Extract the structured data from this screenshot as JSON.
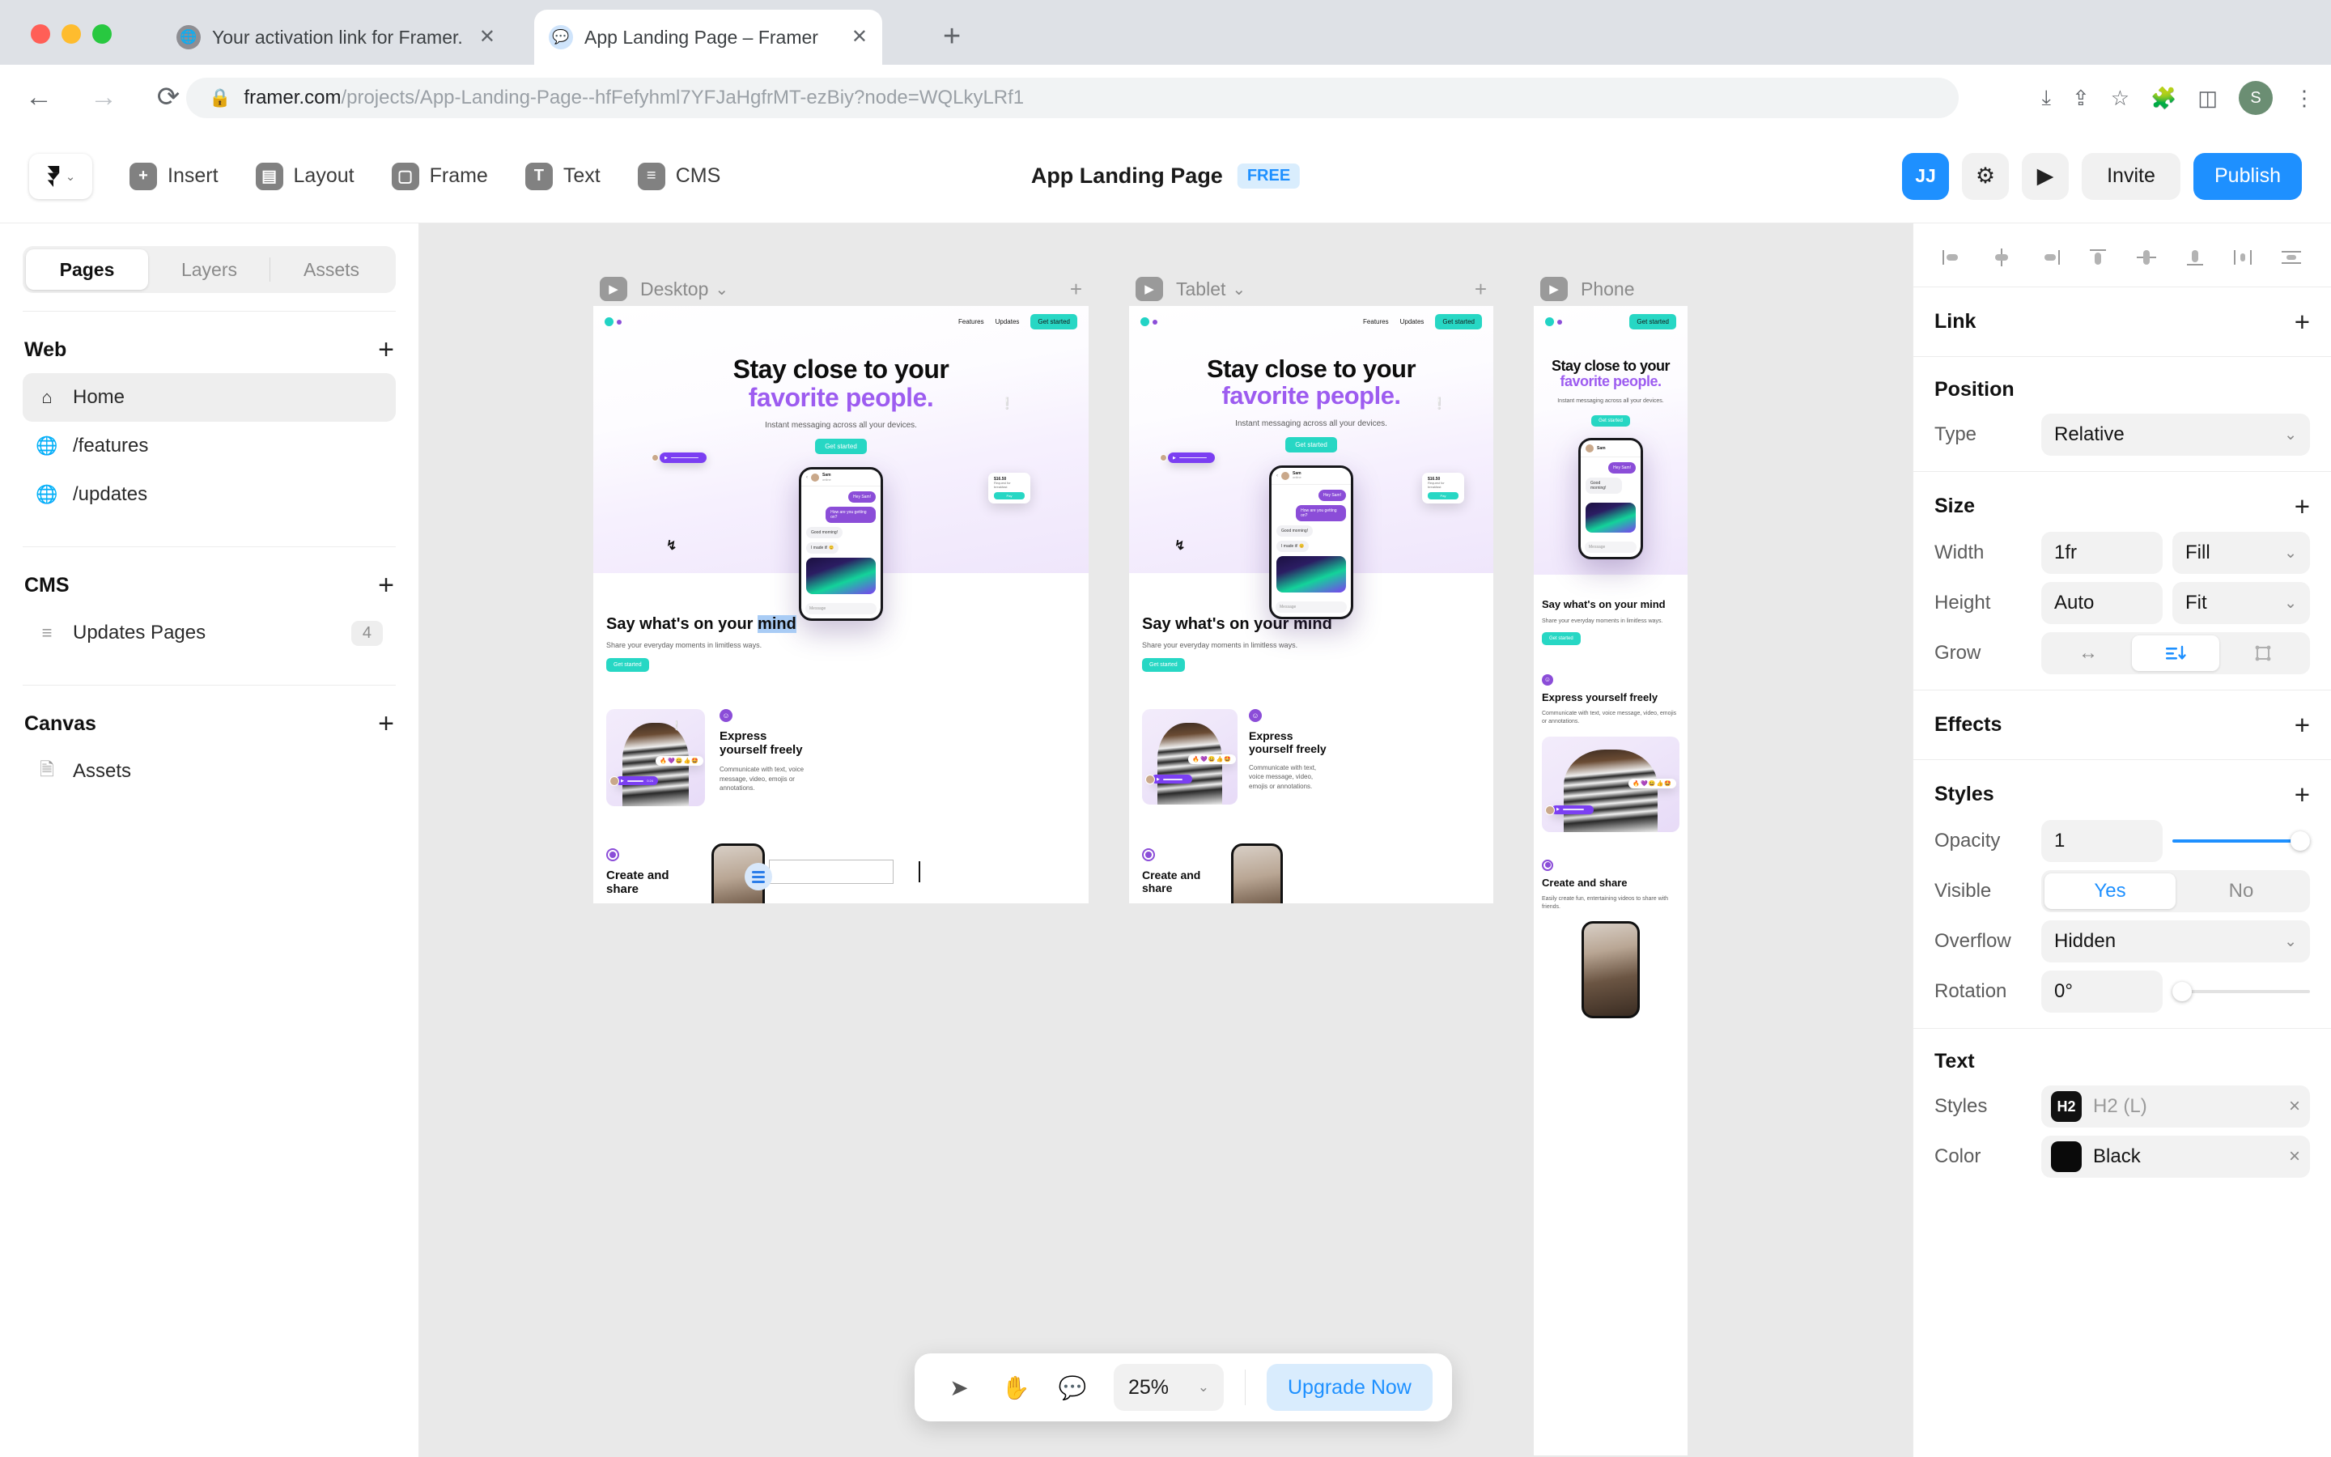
{
  "browser": {
    "tabs": [
      {
        "title": "Your activation link for Framer.",
        "favicon": "globe-icon",
        "active": false
      },
      {
        "title": "App Landing Page – Framer",
        "favicon": "chat-icon",
        "active": true
      }
    ],
    "new_tab_label": "+",
    "nav": {
      "back": "←",
      "forward": "→",
      "reload": "⟳"
    },
    "address": {
      "lock": "🔒",
      "domain": "framer.com",
      "path": "/projects/App-Landing-Page--hfFefyhml7YFJaHgfrMT-ezBiy?node=WQLkyLRf1"
    },
    "omni_icons": [
      "download-icon",
      "share-icon",
      "bookmark-icon",
      "extensions-icon",
      "sidepanel-icon",
      "menu-icon"
    ],
    "profile_initial": "S"
  },
  "appbar": {
    "logo": "framer-logo",
    "items": [
      {
        "label": "Insert",
        "icon": "plus-square-icon"
      },
      {
        "label": "Layout",
        "icon": "layout-icon"
      },
      {
        "label": "Frame",
        "icon": "frame-icon"
      },
      {
        "label": "Text",
        "icon": "text-icon"
      },
      {
        "label": "CMS",
        "icon": "database-icon"
      }
    ],
    "document_title": "App Landing Page",
    "plan_badge": "FREE",
    "avatar_initials": "JJ",
    "settings_icon": "gear-icon",
    "preview_icon": "play-icon",
    "invite_label": "Invite",
    "publish_label": "Publish"
  },
  "sidebar": {
    "tabs": [
      {
        "label": "Pages",
        "active": true
      },
      {
        "label": "Layers",
        "active": false
      },
      {
        "label": "Assets",
        "active": false
      }
    ],
    "groups": [
      {
        "title": "Web",
        "add_label": "+",
        "items": [
          {
            "label": "Home",
            "icon": "home-icon",
            "selected": true,
            "count": ""
          },
          {
            "label": "/features",
            "icon": "globe-icon",
            "selected": false,
            "count": ""
          },
          {
            "label": "/updates",
            "icon": "globe-icon",
            "selected": false,
            "count": ""
          }
        ]
      },
      {
        "title": "CMS",
        "add_label": "+",
        "items": [
          {
            "label": "Updates Pages",
            "icon": "database-icon",
            "selected": false,
            "count": "4"
          }
        ]
      },
      {
        "title": "Canvas",
        "add_label": "+",
        "items": [
          {
            "label": "Assets",
            "icon": "file-icon",
            "selected": false,
            "count": ""
          }
        ]
      }
    ]
  },
  "canvas": {
    "frames": [
      {
        "name": "Desktop",
        "has_dropdown": true,
        "has_add": true
      },
      {
        "name": "Tablet",
        "has_dropdown": true,
        "has_add": true
      },
      {
        "name": "Phone",
        "has_dropdown": false,
        "has_add": false
      }
    ],
    "site": {
      "nav_links": [
        "Features",
        "Updates"
      ],
      "nav_cta": "Get started",
      "hero_title_line1": "Stay close to your",
      "hero_title_line2": "favorite people.",
      "hero_sub": "Instant messaging across all your devices.",
      "hero_cta": "Get started",
      "chat": {
        "contact_name": "Sam",
        "contact_status": "online",
        "messages": [
          {
            "side": "me",
            "text": "Hey Sam!"
          },
          {
            "side": "me",
            "text": "How are you getting on?"
          },
          {
            "side": "them",
            "text": "Good morning!"
          },
          {
            "side": "them",
            "text": "I made it! 😊"
          }
        ],
        "input_placeholder": "Message",
        "payment_card": {
          "amount": "$16.50",
          "label": "Request for breakfast",
          "button": "Pay"
        },
        "reaction": "😍"
      },
      "sections": [
        {
          "icon": "smiley-icon",
          "title": "Say what's on your mind",
          "body": "Share your everyday moments in limitless ways.",
          "cta": "Get started"
        },
        {
          "icon": "smiley-icon",
          "title_line1": "Express",
          "title_line2": "yourself freely",
          "body": "Communicate with text, voice message, video, emojis or annotations.",
          "emojis": "🔥💜😀👍🤩",
          "voice_time": "0:24"
        },
        {
          "icon": "circle-icon",
          "title_line1": "Create and",
          "title_line2": "share",
          "body": "Easily create fun, entertaining videos to share with friends."
        }
      ]
    },
    "editing": {
      "text_value": "Say what's on your mind",
      "selected_fragment": "mind",
      "unselected_prefix": "Say what's on your "
    }
  },
  "bottombar": {
    "tools": [
      {
        "icon": "cursor-icon",
        "active": true
      },
      {
        "icon": "hand-icon",
        "active": false
      },
      {
        "icon": "comment-icon",
        "active": false
      }
    ],
    "zoom_value": "25%",
    "zoom_chevron": "⌄",
    "upgrade_label": "Upgrade Now"
  },
  "rightpanel": {
    "align_buttons": [
      "align-left-icon",
      "align-horizontal-center-icon",
      "align-right-icon",
      "align-top-icon",
      "align-vertical-center-icon",
      "align-bottom-icon",
      "distribute-horizontal-icon",
      "distribute-vertical-icon"
    ],
    "link": {
      "title": "Link",
      "add": "+"
    },
    "position": {
      "title": "Position",
      "type_label": "Type",
      "type_value": "Relative"
    },
    "size": {
      "title": "Size",
      "add": "+",
      "width_label": "Width",
      "width_value": "1fr",
      "width_mode": "Fill",
      "height_label": "Height",
      "height_value": "Auto",
      "height_mode": "Fit",
      "grow_label": "Grow",
      "grow_options": [
        "horizontal-arrows-icon",
        "stack-down-icon",
        "resize-icon"
      ],
      "grow_selected": 1
    },
    "effects": {
      "title": "Effects",
      "add": "+"
    },
    "styles": {
      "title": "Styles",
      "add": "+",
      "opacity_label": "Opacity",
      "opacity_value": "1",
      "visible_label": "Visible",
      "visible_yes": "Yes",
      "visible_no": "No",
      "visible_selected": "Yes",
      "overflow_label": "Overflow",
      "overflow_value": "Hidden",
      "rotation_label": "Rotation",
      "rotation_value": "0°"
    },
    "text": {
      "title": "Text",
      "styles_label": "Styles",
      "style_badge": "H2",
      "style_name": "H2",
      "style_suffix": "(L)",
      "remove": "×",
      "color_label": "Color",
      "color_value": "Black"
    }
  },
  "colors": {
    "accent_blue": "#1e90ff",
    "teal": "#27d7c4",
    "purple": "#9d5cf0",
    "canvas_bg": "#e9e9e9"
  }
}
